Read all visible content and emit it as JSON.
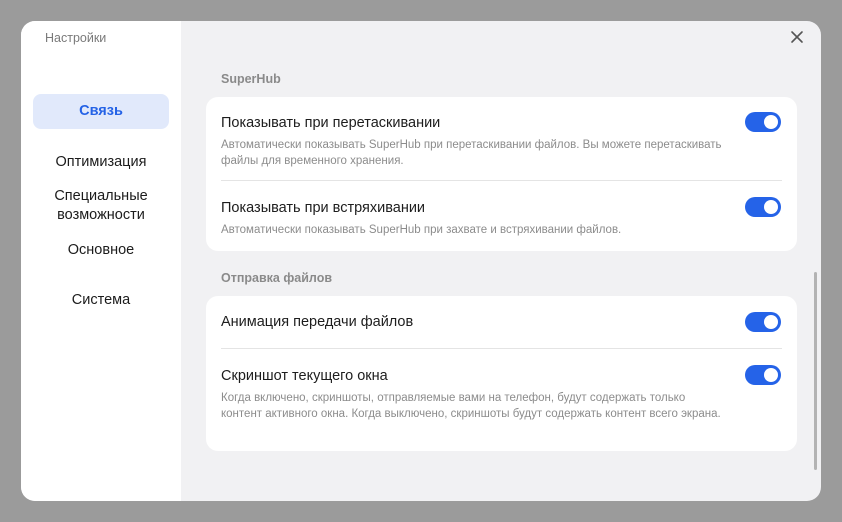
{
  "app": {
    "title": "Настройки"
  },
  "sidebar": {
    "items": [
      {
        "label": "Связь"
      },
      {
        "label": "Оптимизация"
      },
      {
        "label": "Специальные возможности"
      },
      {
        "label": "Основное"
      },
      {
        "label": "Система"
      }
    ],
    "active_index": 0
  },
  "sections": [
    {
      "title": "SuperHub",
      "items": [
        {
          "title": "Показывать при перетаскивании",
          "description": "Автоматически показывать SuperHub при перетаскивании файлов. Вы можете перетаскивать файлы для временного хранения.",
          "enabled": true
        },
        {
          "title": "Показывать при встряхивании",
          "description": "Автоматически показывать SuperHub при захвате и встряхивании файлов.",
          "enabled": true
        }
      ]
    },
    {
      "title": "Отправка файлов",
      "items": [
        {
          "title": "Анимация передачи файлов",
          "description": "",
          "enabled": true
        },
        {
          "title": "Скриншот текущего окна",
          "description": "Когда включено, скриншоты, отправляемые вами на телефон, будут содержать только контент активного окна. Когда выключено, скриншоты будут содержать контент всего экрана.",
          "enabled": true
        }
      ]
    }
  ],
  "icons": {
    "close": "close-icon"
  },
  "colors": {
    "accent": "#2563e8",
    "active_nav_bg": "#e1e9fb",
    "active_nav_text": "#2462e6"
  }
}
